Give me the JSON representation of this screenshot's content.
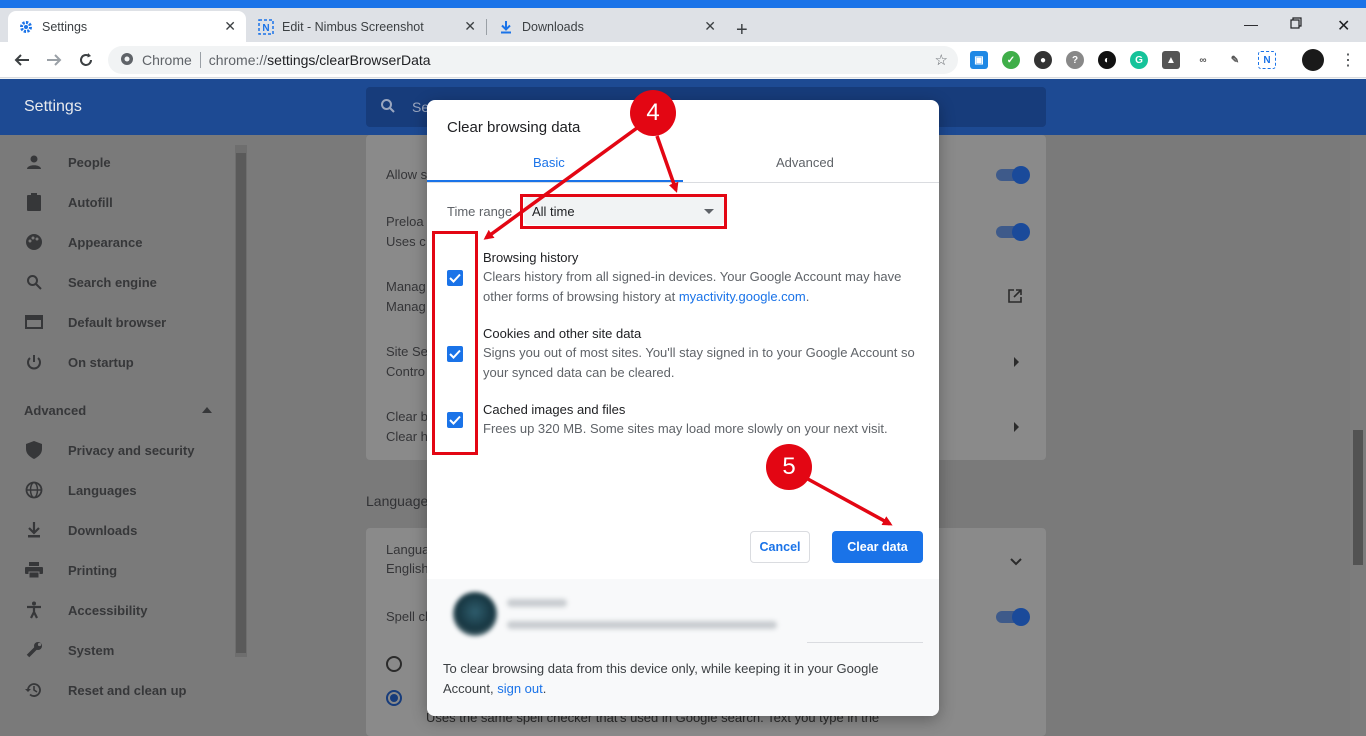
{
  "tabs": [
    {
      "label": "Settings",
      "icon": "gear-icon"
    },
    {
      "label": "Edit - Nimbus Screenshot",
      "icon": "nimbus-icon"
    },
    {
      "label": "Downloads",
      "icon": "download-icon"
    }
  ],
  "omnibox": {
    "chip": "Chrome",
    "url_prefix": "chrome://",
    "url_path": "settings/clearBrowserData"
  },
  "settings": {
    "app_title": "Settings",
    "search_placeholder": "Se",
    "sidebar": [
      {
        "label": "People",
        "icon": "person-icon"
      },
      {
        "label": "Autofill",
        "icon": "clipboard-icon"
      },
      {
        "label": "Appearance",
        "icon": "palette-icon"
      },
      {
        "label": "Search engine",
        "icon": "search-icon"
      },
      {
        "label": "Default browser",
        "icon": "browser-icon"
      },
      {
        "label": "On startup",
        "icon": "power-icon"
      }
    ],
    "advanced_label": "Advanced",
    "advanced_items": [
      {
        "label": "Privacy and security",
        "icon": "shield-icon"
      },
      {
        "label": "Languages",
        "icon": "globe-icon"
      },
      {
        "label": "Downloads",
        "icon": "download-icon"
      },
      {
        "label": "Printing",
        "icon": "printer-icon"
      },
      {
        "label": "Accessibility",
        "icon": "accessibility-icon"
      },
      {
        "label": "System",
        "icon": "wrench-icon"
      },
      {
        "label": "Reset and clean up",
        "icon": "history-icon"
      }
    ],
    "rows": {
      "allow": "Allow s",
      "preload": "Preloa",
      "preload_sub": "Uses c",
      "manage": "Manag",
      "manage_sub": "Manag",
      "site": "Site Se",
      "site_sub": "Contro",
      "clear": "Clear b",
      "clear_sub": "Clear h"
    },
    "languages_section": "Language",
    "lang_row": "Langua",
    "lang_sub": "English",
    "spell_row": "Spell ch",
    "spell_desc": "Uses the same spell checker that's used in Google search. Text you type in the"
  },
  "dialog": {
    "title": "Clear browsing data",
    "tab_basic": "Basic",
    "tab_advanced": "Advanced",
    "time_range_label": "Time range",
    "time_range_value": "All time",
    "items": [
      {
        "title": "Browsing history",
        "desc": "Clears history from all signed-in devices. Your Google Account may have other forms of browsing history at ",
        "link": "myactivity.google.com",
        "tail": ".",
        "checked": true
      },
      {
        "title": "Cookies and other site data",
        "desc": "Signs you out of most sites. You'll stay signed in to your Google Account so your synced data can be cleared.",
        "checked": true
      },
      {
        "title": "Cached images and files",
        "desc": "Frees up 320 MB. Some sites may load more slowly on your next visit.",
        "checked": true
      }
    ],
    "cancel": "Cancel",
    "clear": "Clear data",
    "footer_text": "To clear browsing data from this device only, while keeping it in your Google Account, ",
    "footer_link": "sign out",
    "footer_tail": "."
  },
  "annotations": {
    "step4": "4",
    "step5": "5"
  },
  "colors": {
    "accent": "#1a73e8",
    "appbar": "#1d4a93",
    "annotation": "#e30613"
  }
}
